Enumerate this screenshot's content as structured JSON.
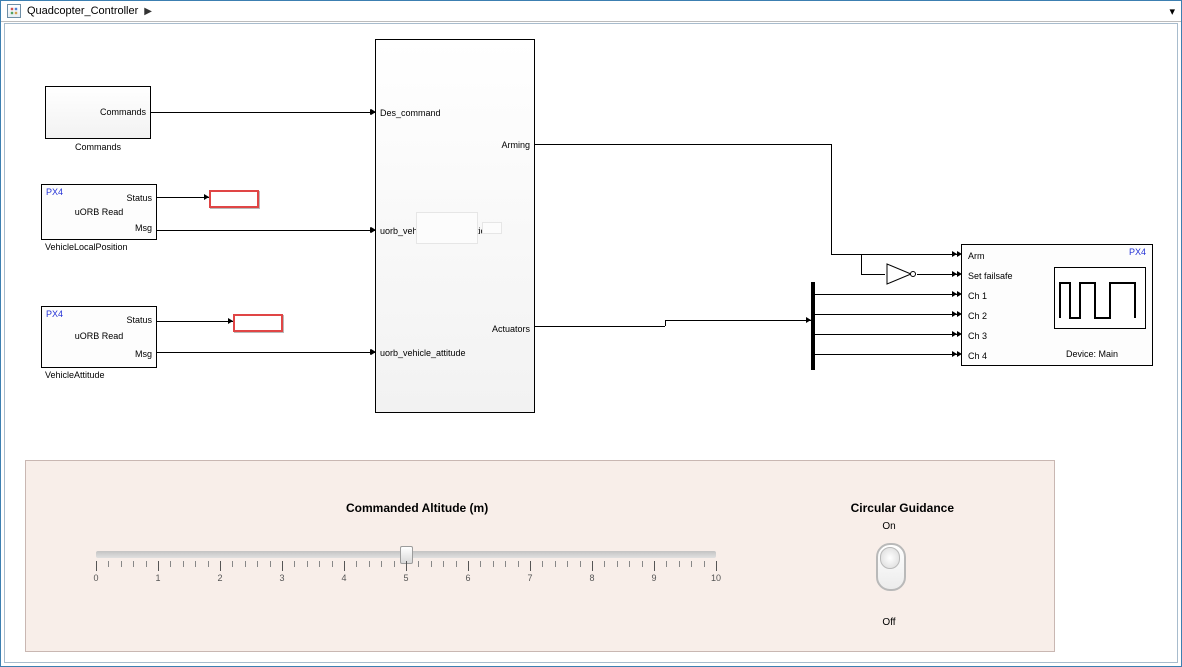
{
  "titlebar": {
    "model_name": "Quadcopter_Controller",
    "chevron": "▶",
    "menu_caret": "▾"
  },
  "blocks": {
    "commands": {
      "port_out": "Commands",
      "caption": "Commands"
    },
    "uorb1": {
      "vendor": "PX4",
      "title": "uORB Read",
      "topic": "VehicleLocalPosition",
      "port_status": "Status",
      "port_msg": "Msg"
    },
    "uorb2": {
      "vendor": "PX4",
      "title": "uORB Read",
      "topic": "VehicleAttitude",
      "port_status": "Status",
      "port_msg": "Msg"
    },
    "controller": {
      "in_1": "Des_command",
      "in_2": "uorb_vehicle_local_position",
      "in_3": "uorb_vehicle_attitude",
      "out_1": "Arming",
      "out_2": "Actuators"
    },
    "output": {
      "vendor": "PX4",
      "in_arm": "Arm",
      "in_failsafe": "Set failsafe",
      "in_ch1": "Ch 1",
      "in_ch2": "Ch 2",
      "in_ch3": "Ch 3",
      "in_ch4": "Ch 4",
      "caption": "Device: Main"
    }
  },
  "dashboard": {
    "slider_title": "Commanded Altitude (m)",
    "slider_min": 0,
    "slider_max": 10,
    "slider_value": 5,
    "toggle_title": "Circular Guidance",
    "toggle_on": "On",
    "toggle_off": "Off"
  }
}
